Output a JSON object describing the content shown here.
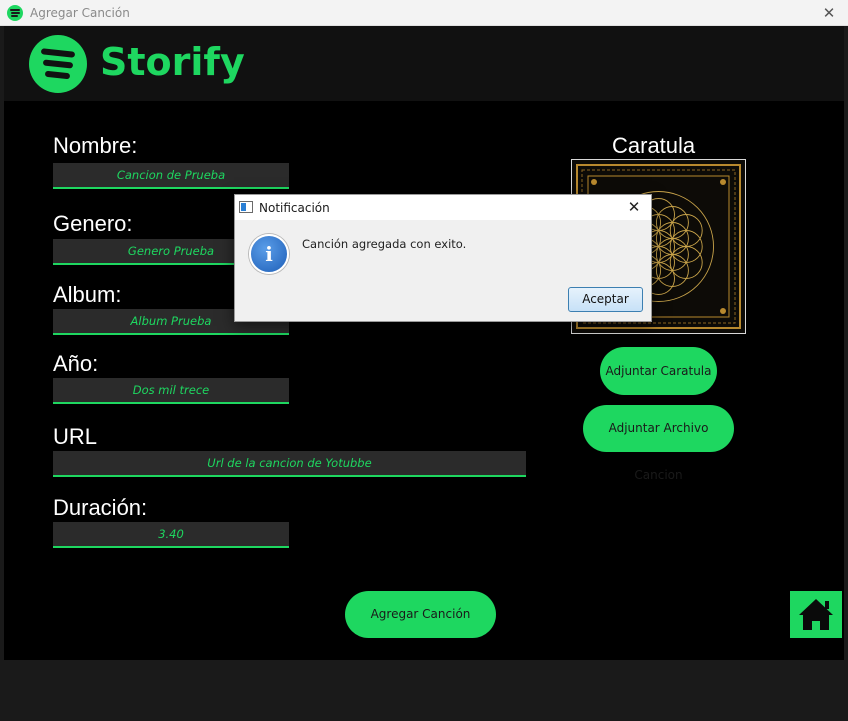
{
  "window": {
    "title": "Agregar Canción",
    "close_glyph": "✕"
  },
  "header": {
    "brand": "Storify",
    "logo_icon": "spotify-logo-icon"
  },
  "form": {
    "nombre_label": "Nombre:",
    "nombre_value": "Cancion de Prueba",
    "genero_label": "Genero:",
    "genero_value": "Genero Prueba",
    "album_label": "Album:",
    "album_value": "Album Prueba",
    "anio_label": "Año:",
    "anio_value": "Dos mil trece",
    "url_label": "URL",
    "url_value": "Url de la cancion de Yotubbe",
    "duracion_label": "Duración:",
    "duracion_value": "3.40"
  },
  "cover": {
    "label": "Caratula",
    "attach_cover_label": "Adjuntar Caratula",
    "attach_file_label": "Adjuntar Archivo Cancion"
  },
  "actions": {
    "add_song_label": "Agregar Canción",
    "home_icon": "home-icon"
  },
  "dialog": {
    "title": "Notificación",
    "close_glyph": "✕",
    "info_glyph": "i",
    "message": "Canción agregada con exito.",
    "accept_label": "Aceptar"
  },
  "colors": {
    "accent": "#1ed760",
    "background": "#000000",
    "header": "#111111",
    "field": "#2b2b2b"
  }
}
